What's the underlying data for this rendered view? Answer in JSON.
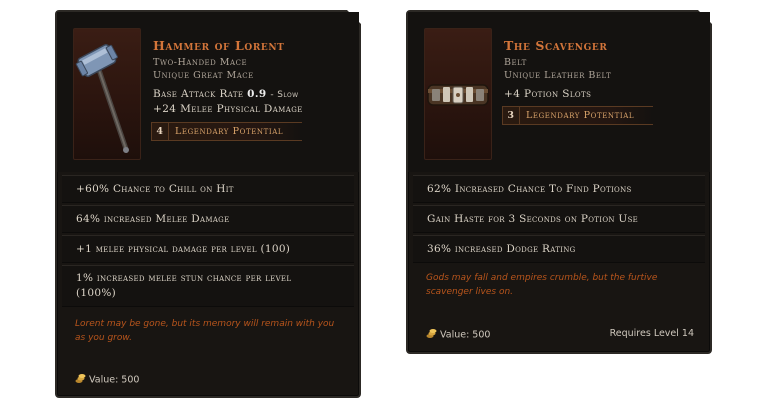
{
  "items": [
    {
      "name": "Hammer of Lorent",
      "type_line": "Two-Handed Mace",
      "rarity_line": "Unique Great Mace",
      "base_stat_label": "Base Attack Rate",
      "base_stat_value": "0.9",
      "base_stat_note": "- Slow",
      "implicit": "+24 Melee Physical Damage",
      "legendary_potential_value": "4",
      "legendary_potential_label": "Legendary Potential",
      "affixes": [
        "+60% Chance to Chill on Hit",
        "64% increased Melee Damage",
        "+1 melee physical damage per level (100)",
        "1% increased melee stun chance per level (100%)"
      ],
      "flavor": "Lorent may be gone, but its memory will remain with you as you grow.",
      "value": "Value: 500",
      "requirement": ""
    },
    {
      "name": "The Scavenger",
      "type_line": "Belt",
      "rarity_line": "Unique Leather Belt",
      "implicit": "+4 Potion Slots",
      "legendary_potential_value": "3",
      "legendary_potential_label": "Legendary Potential",
      "affixes": [
        "62% Increased Chance To Find Potions",
        "Gain Haste for 3 Seconds on Potion Use",
        "36% increased Dodge Rating"
      ],
      "flavor": "Gods may fall and empires crumble, but the furtive scavenger lives on.",
      "value": "Value: 500",
      "requirement": "Requires Level 14"
    }
  ],
  "colors": {
    "title": "#d3753a",
    "flavor": "#b8551c",
    "panel": "#181512",
    "row": "#141210"
  },
  "icons": [
    "great-mace-icon",
    "leather-belt-icon",
    "gold-coin-icon"
  ]
}
